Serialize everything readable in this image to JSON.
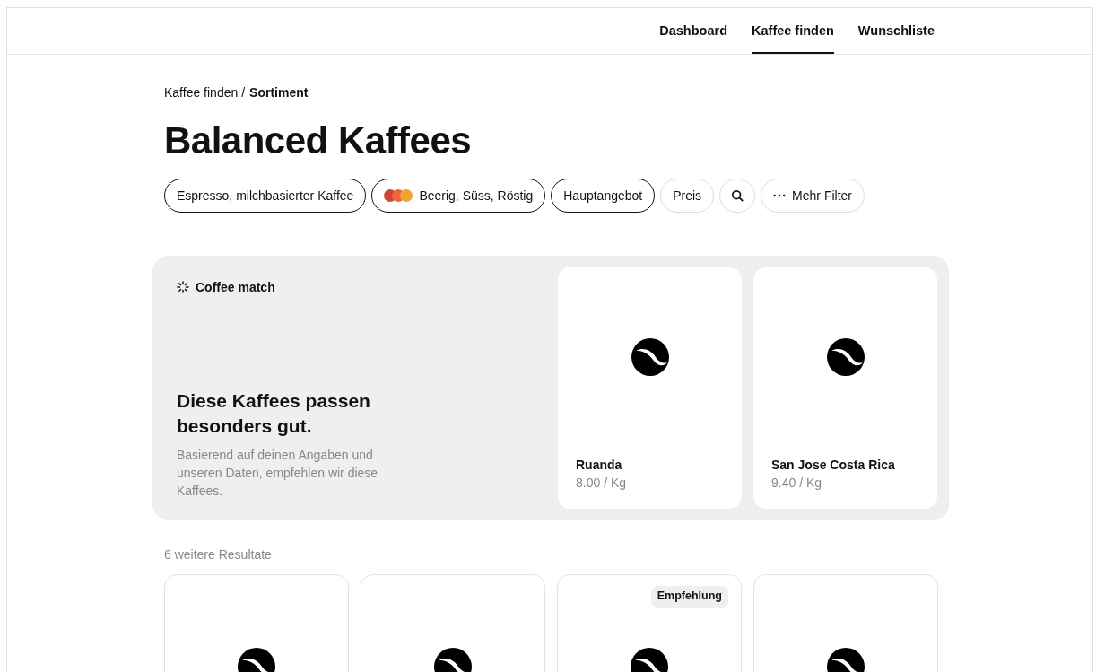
{
  "nav": [
    {
      "label": "Dashboard",
      "selected": false
    },
    {
      "label": "Kaffee finden",
      "selected": true
    },
    {
      "label": "Wunschliste",
      "selected": false
    }
  ],
  "breadcrumb": {
    "parent": "Kaffee finden /",
    "current": "Sortiment"
  },
  "title": "Balanced Kaffees",
  "filters": [
    {
      "kind": "text",
      "label": "Espresso, milchbasierter Kaffee",
      "active": true
    },
    {
      "kind": "flavor",
      "label": "Beerig, Süss, Röstig",
      "active": true
    },
    {
      "kind": "text",
      "label": "Hauptangebot",
      "active": true
    },
    {
      "kind": "text",
      "label": "Preis",
      "active": false
    },
    {
      "kind": "search",
      "active": false
    },
    {
      "kind": "more",
      "label": "Mehr Filter",
      "active": false
    }
  ],
  "match": {
    "label": "Coffee match",
    "heading": "Diese Kaffees passen besonders gut.",
    "text": "Basierend auf deinen Angaben und unseren Daten, empfehlen wir diese Kaffees.",
    "coffees": [
      {
        "name": "Ruanda",
        "price": "8.00 / Kg"
      },
      {
        "name": "San Jose Costa Rica",
        "price": "9.40 / Kg"
      }
    ]
  },
  "results": {
    "count": "6 weitere Resultate",
    "cards": [
      {
        "kind": "plain"
      },
      {
        "kind": "plain"
      },
      {
        "kind": "badged",
        "badge": "Empfehlung"
      },
      {
        "kind": "plain"
      }
    ]
  }
}
